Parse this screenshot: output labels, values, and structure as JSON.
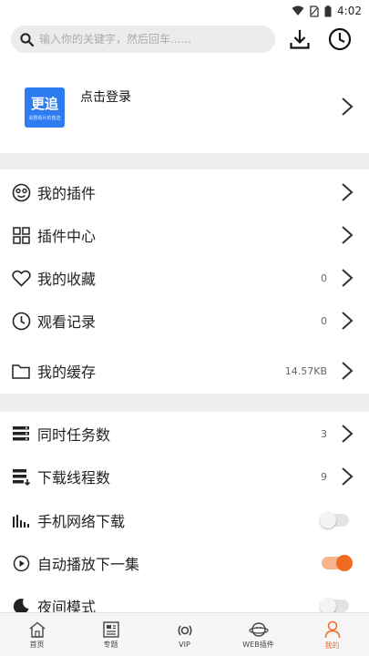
{
  "status": {
    "time": "4:02"
  },
  "search": {
    "placeholder": "输入你的关键字，然后回车......"
  },
  "profile": {
    "logo_text": "更追",
    "logo_sub": "追剧看片的首选",
    "login_label": "点击登录"
  },
  "menu_group1": [
    {
      "label": "我的插件",
      "value": "",
      "icon": "plugin-face-icon"
    },
    {
      "label": "插件中心",
      "value": "",
      "icon": "grid-icon"
    },
    {
      "label": "我的收藏",
      "value": "0",
      "icon": "heart-icon"
    },
    {
      "label": "观看记录",
      "value": "0",
      "icon": "clock-icon"
    },
    {
      "label": "我的缓存",
      "value": "14.57KB",
      "icon": "folder-icon"
    }
  ],
  "menu_group2": [
    {
      "label": "同时任务数",
      "value": "3",
      "icon": "tasks-icon"
    },
    {
      "label": "下载线程数",
      "value": "9",
      "icon": "threads-icon"
    },
    {
      "label": "手机网络下载",
      "toggle": false,
      "icon": "signal-icon"
    },
    {
      "label": "自动播放下一集",
      "toggle": true,
      "icon": "play-circle-icon"
    },
    {
      "label": "夜间模式",
      "toggle": false,
      "icon": "moon-icon"
    }
  ],
  "tabbar": [
    {
      "label": "首页",
      "icon": "home-icon",
      "active": false
    },
    {
      "label": "专题",
      "icon": "topic-icon",
      "active": false
    },
    {
      "label": "VIP",
      "icon": "vip-icon",
      "active": false
    },
    {
      "label": "WEB插件",
      "icon": "web-plugin-icon",
      "active": false
    },
    {
      "label": "我的",
      "icon": "person-icon",
      "active": true
    }
  ],
  "colors": {
    "accent": "#f26a21",
    "logo_blue": "#2d7df0"
  }
}
